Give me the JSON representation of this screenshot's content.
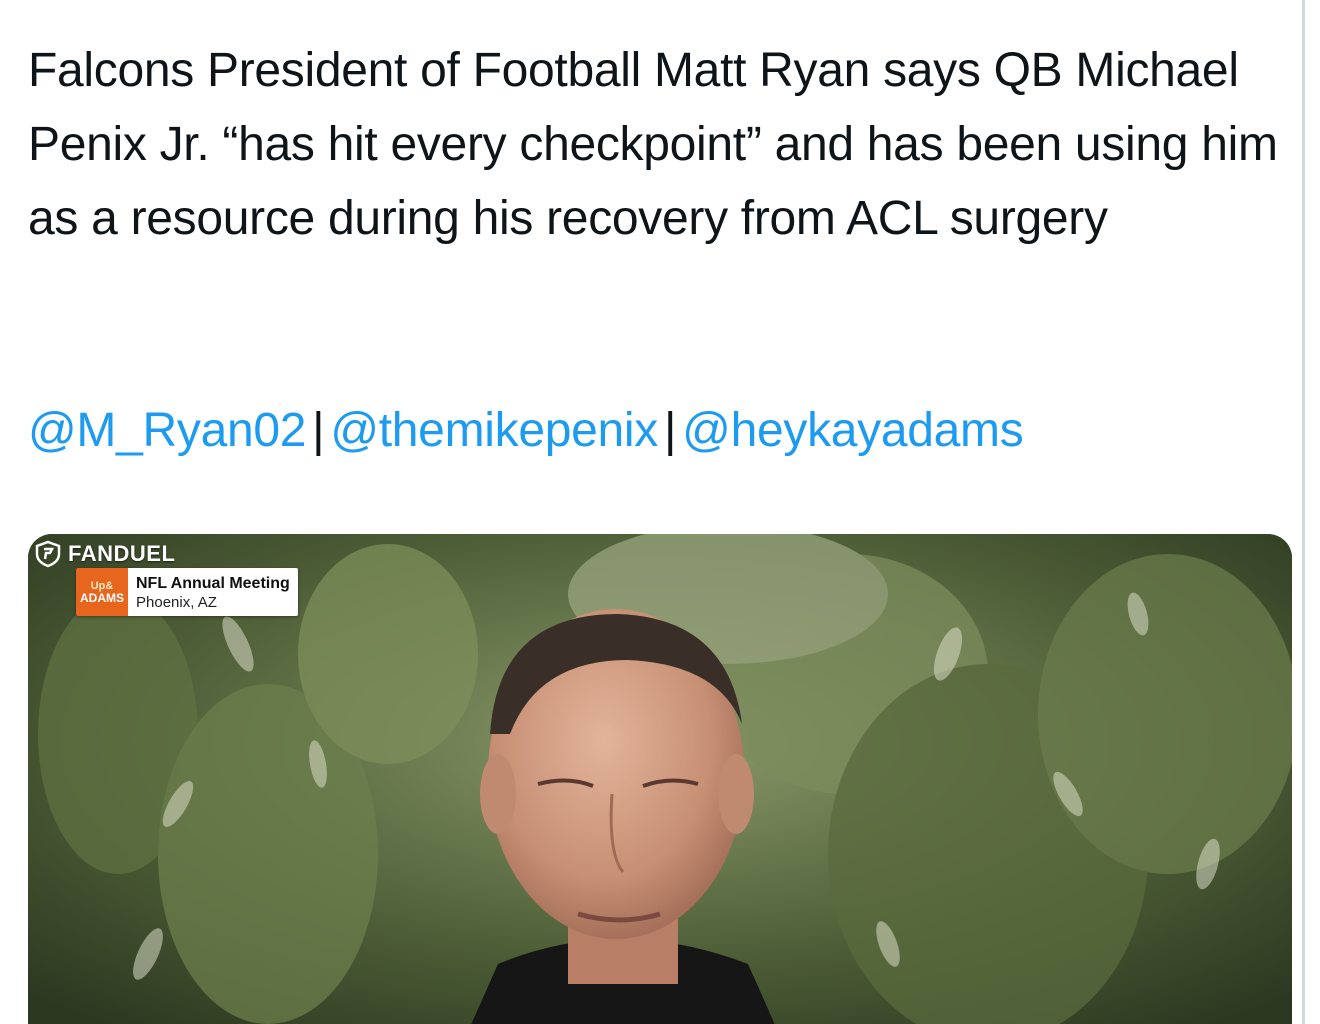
{
  "tweet": {
    "text": "Falcons President of Football Matt Ryan says QB Michael Penix Jr. “has hit every checkpoint” and has been using him as a resource during his recovery from ACL surgery",
    "mentions": [
      "@M_Ryan02",
      "@themikepenix",
      "@heykayadams"
    ],
    "mention_separator": "|"
  },
  "media": {
    "brand_label": "FANDUEL",
    "show_logo_line1": "Up&",
    "show_logo_line2": "ADAMS",
    "event_title": "NFL Annual Meeting",
    "event_location": "Phoenix, AZ"
  },
  "colors": {
    "text": "#0f1419",
    "link": "#1d9bf0",
    "show_logo_bg": "#e8651d"
  }
}
